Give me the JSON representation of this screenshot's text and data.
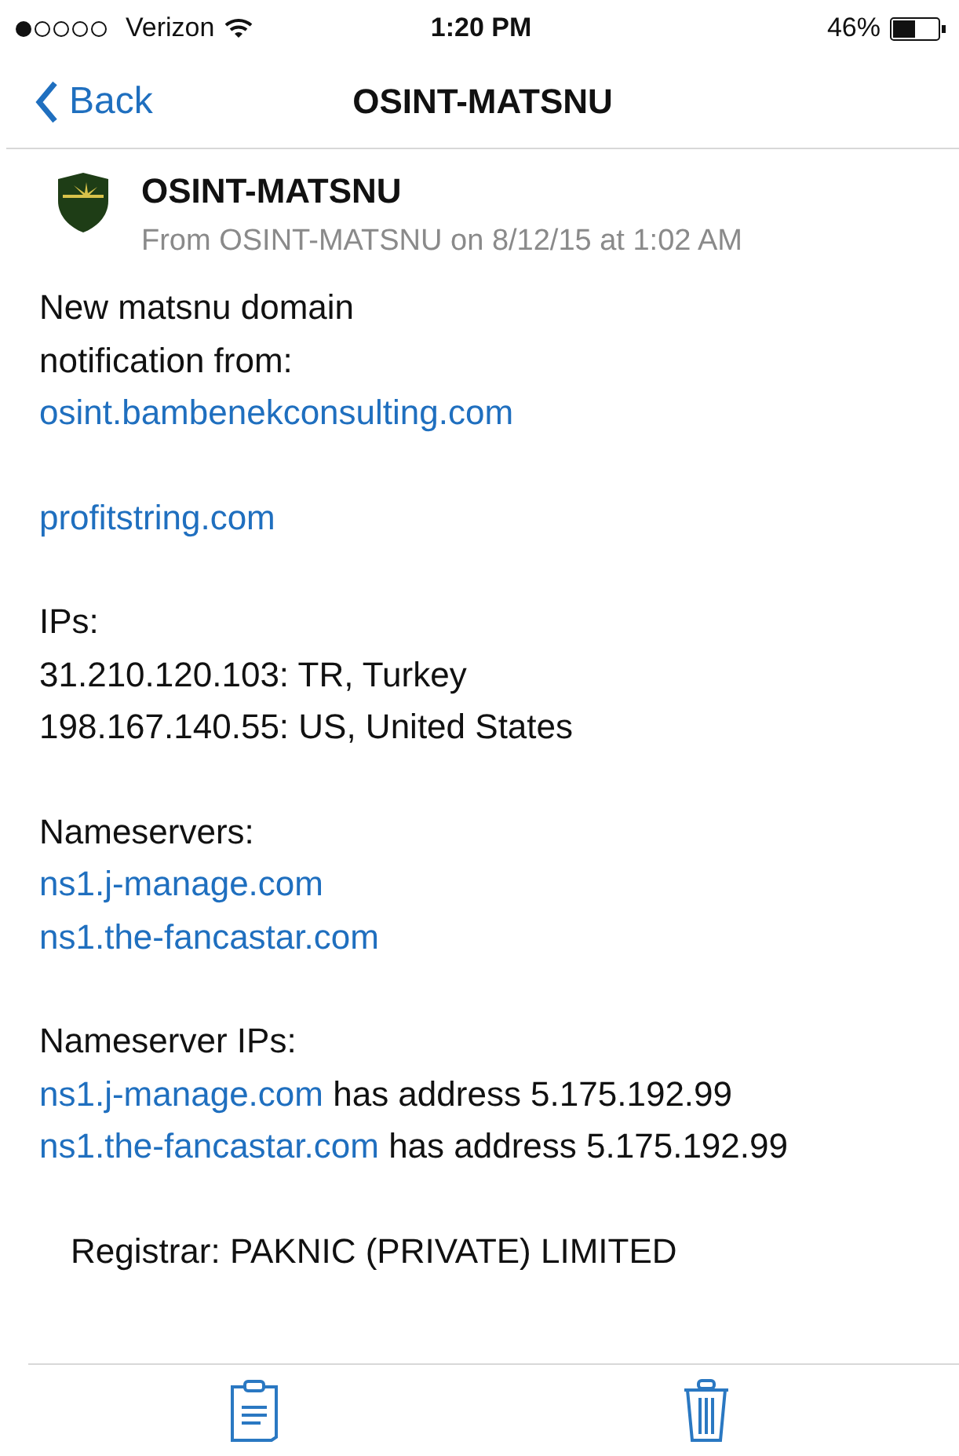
{
  "status_bar": {
    "carrier": "Verizon",
    "time": "1:20 PM",
    "battery": "46%"
  },
  "nav": {
    "back": "Back",
    "title": "OSINT-MATSNU"
  },
  "message": {
    "sender": "OSINT-MATSNU",
    "meta": "From OSINT-MATSNU on 8/12/15 at 1:02 AM",
    "paragraphs": [
      {
        "kind": "block",
        "lines": [
          [
            {
              "kind": "text",
              "text": "New matsnu domain"
            }
          ],
          [
            {
              "kind": "text",
              "text": "notification from:"
            }
          ],
          [
            {
              "kind": "link",
              "text": "osint.bambenekconsulting.com"
            }
          ]
        ]
      },
      {
        "kind": "block",
        "lines": [
          [
            {
              "kind": "link",
              "text": "profitstring.com"
            }
          ]
        ]
      },
      {
        "kind": "block",
        "lines": [
          [
            {
              "kind": "text",
              "text": "IPs:"
            }
          ],
          [
            {
              "kind": "text",
              "text": "31.210.120.103: TR, Turkey"
            }
          ],
          [
            {
              "kind": "text",
              "text": "198.167.140.55: US, United States"
            }
          ]
        ]
      },
      {
        "kind": "block",
        "lines": [
          [
            {
              "kind": "text",
              "text": "Nameservers:"
            }
          ],
          [
            {
              "kind": "link",
              "text": "ns1.j-manage.com"
            }
          ],
          [
            {
              "kind": "link",
              "text": "ns1.the-fancastar.com"
            }
          ]
        ]
      },
      {
        "kind": "block",
        "lines": [
          [
            {
              "kind": "text",
              "text": "Nameserver IPs:"
            }
          ],
          [
            {
              "kind": "link",
              "text": "ns1.j-manage.com"
            },
            {
              "kind": "text",
              "text": " has address 5.175.192.99"
            }
          ],
          [
            {
              "kind": "link",
              "text": "ns1.the-fancastar.com"
            },
            {
              "kind": "text",
              "text": " has address 5.175.192.99"
            }
          ]
        ]
      },
      {
        "kind": "indented",
        "lines": [
          [
            {
              "kind": "text",
              "text": "Registrar: PAKNIC (PRIVATE) LIMITED"
            }
          ]
        ]
      }
    ]
  }
}
